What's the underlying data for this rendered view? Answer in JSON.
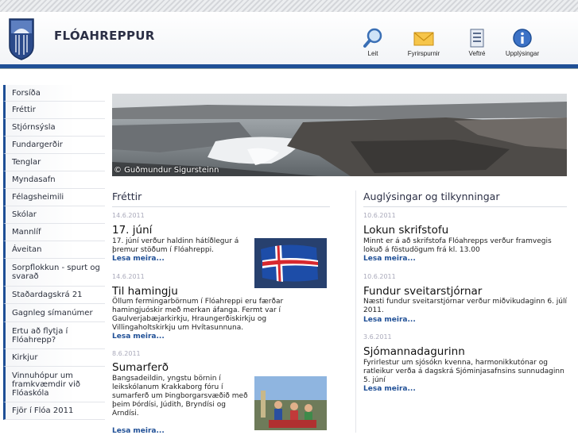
{
  "header": {
    "brand": "FLÓAHREPPUR",
    "tools": [
      {
        "label": "Leit",
        "icon": "magnifier-icon"
      },
      {
        "label": "Fyrirspurnir",
        "icon": "envelope-icon"
      },
      {
        "label": "Veftré",
        "icon": "sitemap-icon"
      },
      {
        "label": "Upplýsingar",
        "icon": "info-icon"
      }
    ]
  },
  "sidebar": {
    "items": [
      {
        "label": "Forsíða"
      },
      {
        "label": "Fréttir"
      },
      {
        "label": "Stjórnsýsla"
      },
      {
        "label": "Fundargerðir"
      },
      {
        "label": "Tenglar"
      },
      {
        "label": "Myndasafn"
      },
      {
        "label": "Félagsheimili"
      },
      {
        "label": "Skólar"
      },
      {
        "label": "Mannlíf"
      },
      {
        "label": "Áveitan"
      },
      {
        "label": "Sorpflokkun - spurt og svarað"
      },
      {
        "label": "Staðardagskrá 21"
      },
      {
        "label": "Gagnleg símanúmer"
      },
      {
        "label": "Ertu að flytja í Flóahrepp?"
      },
      {
        "label": "Kirkjur"
      },
      {
        "label": "Vinnuhópur um framkvæmdir við Flóaskóla"
      },
      {
        "label": "Fjör í Flóa 2011"
      }
    ]
  },
  "banner": {
    "credit": "© Guðmundur Sigursteinn"
  },
  "news": {
    "heading": "Fréttir",
    "items": [
      {
        "date": "14.6.2011",
        "title": "17. júní",
        "body": "17. júní verður haldinn hátíðlegur á þremur stöðum í Flóahreppi.",
        "more": "Lesa meira..."
      },
      {
        "date": "14.6.2011",
        "title": "Til hamingju",
        "body": "Öllum fermingarbörnum í Flóahreppi eru færðar hamingjuóskir með merkan áfanga. Fermt var í Gaulverjabæjarkirkju, Hraungerðiskirkju og Villingaholtskirkju um Hvítasunnuna.",
        "more": "Lesa meira..."
      },
      {
        "date": "8.6.2011",
        "title": "Sumarferð",
        "body": "Bangsadeildin, yngstu börnin í leikskólanum Krakkaborg fóru í sumarferð um Þingborgarsvæðið með þeim Þórdísi, Júdith, Bryndísi og Arndísi.",
        "more": "Lesa meira..."
      }
    ]
  },
  "ads": {
    "heading": "Auglýsingar og tilkynningar",
    "items": [
      {
        "date": "10.6.2011",
        "title": "Lokun skrifstofu",
        "body": "Minnt er á að skrifstofa Flóahrepps verður framvegis lokuð á föstudögum frá kl. 13.00",
        "more": "Lesa meira..."
      },
      {
        "date": "10.6.2011",
        "title": "Fundur sveitarstjórnar",
        "body": "Næsti fundur sveitarstjórnar verður miðvikudaginn 6. júlí 2011.",
        "more": "Lesa meira..."
      },
      {
        "date": "3.6.2011",
        "title": "Sjómannadagurinn",
        "body": "Fyrirlestur um sjósókn kvenna, harmonikkutónar og ratleikur verða á dagskrá Sjóminjasafnsins sunnudaginn 5. júní",
        "more": "Lesa meira..."
      }
    ]
  },
  "colors": {
    "accent": "#1f4f96",
    "heading": "#2b2f45",
    "date": "#aaaabb"
  }
}
